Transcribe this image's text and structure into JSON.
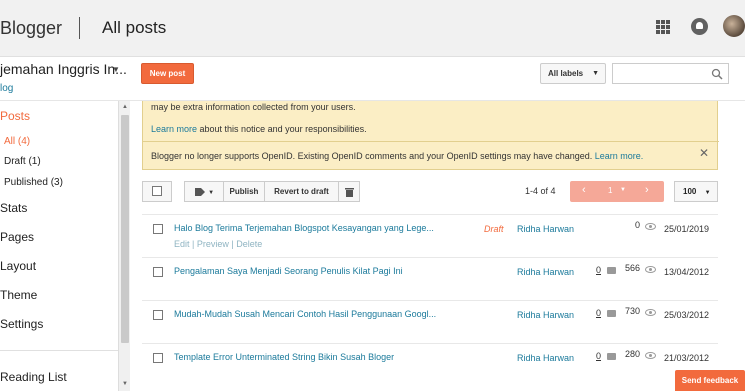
{
  "header": {
    "app_title": "Blogger",
    "page_title": "All posts"
  },
  "blog": {
    "name": "jemahan Inggris In...",
    "sub": "log"
  },
  "actions": {
    "new_post": "New post",
    "labels_select": "All labels",
    "search_placeholder": ""
  },
  "sidebar": {
    "posts": "Posts",
    "sub_items": [
      {
        "label": "All (4)"
      },
      {
        "label": "Draft (1)"
      },
      {
        "label": "Published (3)"
      }
    ],
    "items": [
      {
        "label": "Stats"
      },
      {
        "label": "Pages"
      },
      {
        "label": "Layout"
      },
      {
        "label": "Theme"
      },
      {
        "label": "Settings"
      }
    ],
    "reading_list": "Reading List"
  },
  "notice": {
    "line1": "may be extra information collected from your users.",
    "learn_more": "Learn more",
    "line2_rest": " about this notice and your responsibilities.",
    "openid_text": "Blogger no longer supports OpenID. Existing OpenID comments and your OpenID settings may have changed. ",
    "openid_link": "Learn more."
  },
  "toolbar": {
    "publish": "Publish",
    "revert": "Revert to draft",
    "pager_text": "1-4 of 4",
    "page_number": "1",
    "per_page": "100"
  },
  "posts": [
    {
      "title": "Halo Blog Terima Terjemahan Blogspot Kesayangan yang Lege...",
      "actions": "Edit | Preview | Delete",
      "status": "Draft",
      "author": "Ridha Harwan",
      "comments": "",
      "views": "0",
      "date": "25/01/2019"
    },
    {
      "title": "Pengalaman Saya Menjadi Seorang Penulis Kilat Pagi Ini",
      "actions": "",
      "status": "",
      "author": "Ridha Harwan",
      "comments": "0",
      "views": "566",
      "date": "13/04/2012"
    },
    {
      "title": "Mudah-Mudah Susah Mencari Contoh Hasil Penggunaan Googl...",
      "actions": "",
      "status": "",
      "author": "Ridha Harwan",
      "comments": "0",
      "views": "730",
      "date": "25/03/2012"
    },
    {
      "title": "Template Error Unterminated String Bikin Susah Bloger",
      "actions": "",
      "status": "",
      "author": "Ridha Harwan",
      "comments": "0",
      "views": "280",
      "date": "21/03/2012"
    }
  ],
  "feedback": "Send feedback"
}
